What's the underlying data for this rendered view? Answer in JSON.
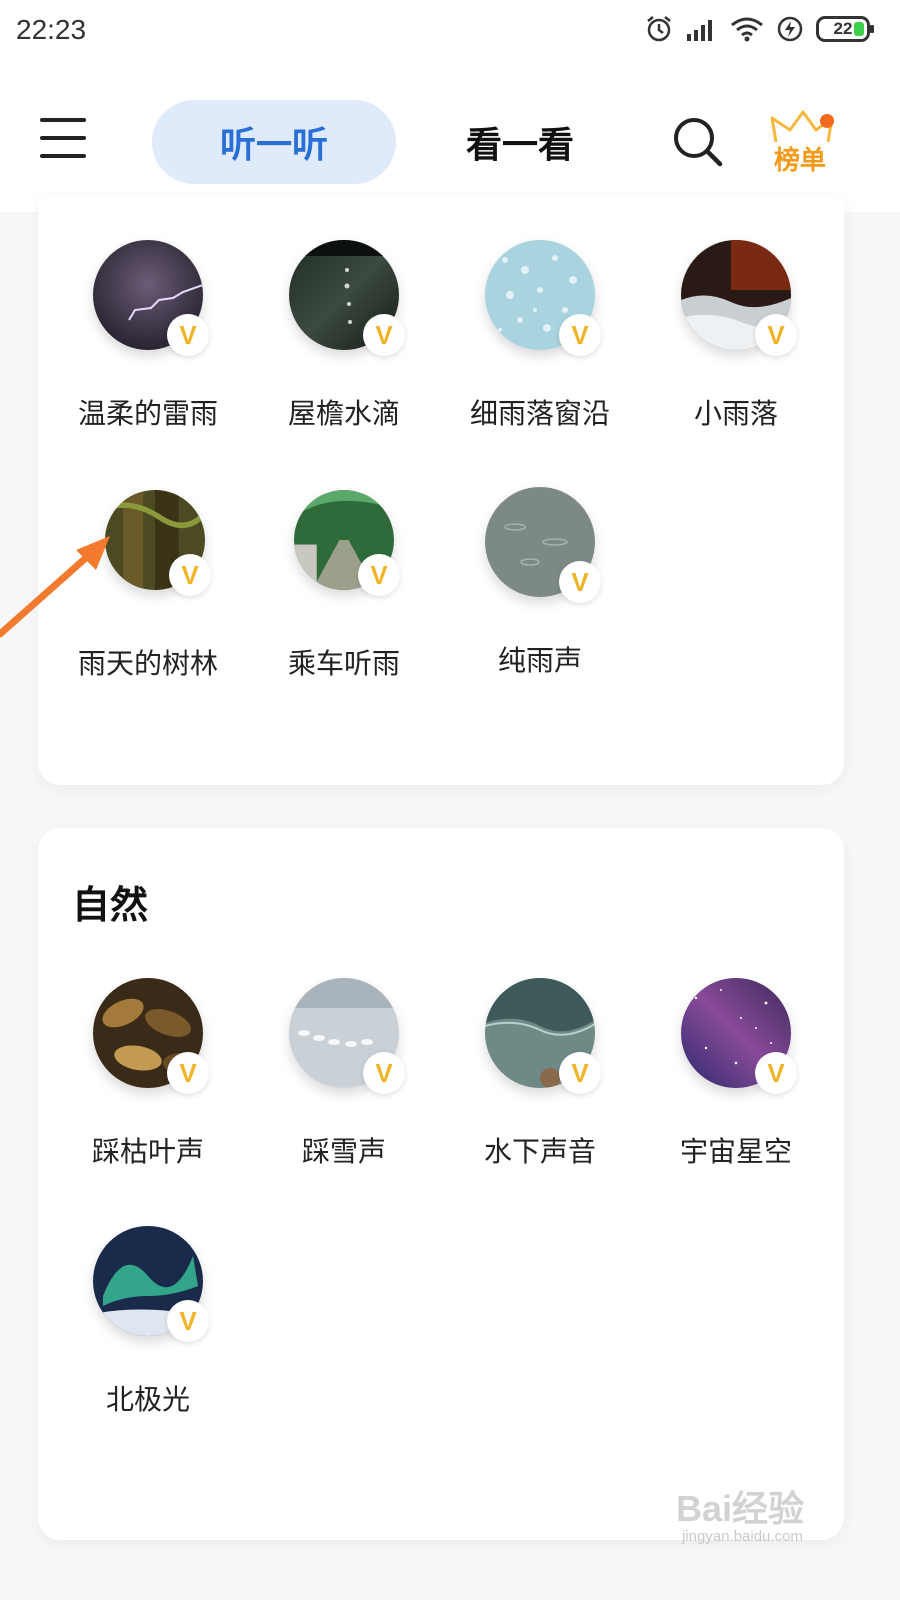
{
  "status_bar": {
    "time": "22:23",
    "battery": "22",
    "icons": [
      "alarm-icon",
      "signal-icon",
      "wifi-icon",
      "charging-icon",
      "battery-icon"
    ]
  },
  "header": {
    "tabs": [
      {
        "label": "听一听",
        "active": true
      },
      {
        "label": "看一看",
        "active": false
      }
    ],
    "rank_label": "榜单",
    "accent_color": "#2a6fd6",
    "active_tab_bg": "#dfeafb",
    "rank_color": "#f39a1a"
  },
  "rain_section": {
    "items": [
      {
        "label": "温柔的雷雨",
        "badge": "V"
      },
      {
        "label": "屋檐水滴",
        "badge": "V"
      },
      {
        "label": "细雨落窗沿",
        "badge": "V"
      },
      {
        "label": "小雨落",
        "badge": "V"
      },
      {
        "label": "雨天的树林",
        "badge": "V"
      },
      {
        "label": "乘车听雨",
        "badge": "V"
      },
      {
        "label": "纯雨声",
        "badge": "V"
      }
    ]
  },
  "nature_section": {
    "title": "自然",
    "items": [
      {
        "label": "踩枯叶声",
        "badge": "V"
      },
      {
        "label": "踩雪声",
        "badge": "V"
      },
      {
        "label": "水下声音",
        "badge": "V"
      },
      {
        "label": "宇宙星空",
        "badge": "V"
      },
      {
        "label": "北极光",
        "badge": "V"
      }
    ]
  },
  "watermark": {
    "main": "Bai经验",
    "sub": "jingyan.baidu.com"
  }
}
